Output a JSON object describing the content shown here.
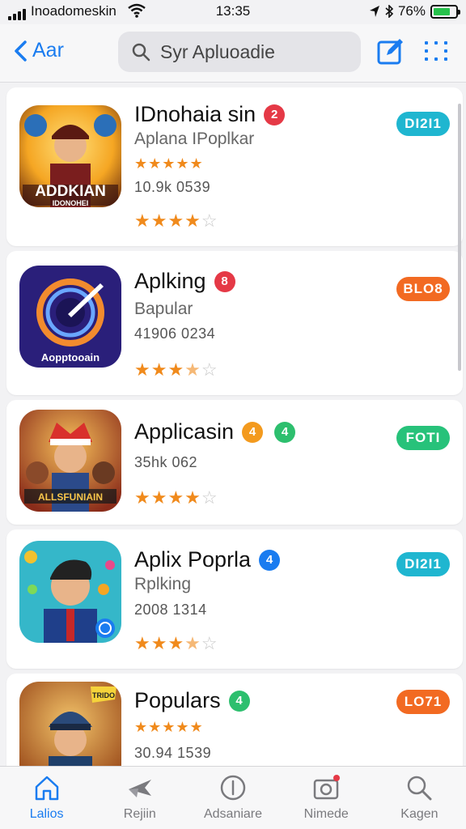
{
  "status_bar": {
    "carrier": "Inoadomeskin",
    "time": "13:35",
    "battery": "76%"
  },
  "nav": {
    "back_label": "Aar",
    "search_placeholder": "Syr Apluoadie"
  },
  "apps": [
    {
      "name": "IDnohaia sin",
      "badge": "2",
      "badge_color": "#e53946",
      "subtitle": "Aplana IPoplkar",
      "meta": "10.9k 0539",
      "top_stars": "★★★★★",
      "rating": 4.5,
      "pill": "DI2I1",
      "pill_color": "#1fb6d0",
      "icon_text_1": "ADDKIAN",
      "icon_text_2": "IDONOHEI"
    },
    {
      "name": "Aplking",
      "badge": "8",
      "badge_color": "#e53946",
      "subtitle": "Bapular",
      "meta": "41906 0234",
      "rating": 3.5,
      "pill": "BLO8",
      "pill_color": "#f26a22",
      "icon_text_1": "Aopptooain"
    },
    {
      "name": "Applicasin",
      "badge": "4",
      "badge_color": "#f39a1e",
      "badge2": "4",
      "badge2_color": "#2dbf6e",
      "meta": "35hk 062",
      "rating": 4.0,
      "pill": "FOTI",
      "pill_color": "#27c27a",
      "icon_text_1": "ALLSFUNIAIN"
    },
    {
      "name": "Aplix Poprla",
      "badge": "4",
      "badge_color": "#1a7cf0",
      "subtitle": "Rplking",
      "meta": "2008 1314",
      "rating": 3.5,
      "pill": "DI2I1",
      "pill_color": "#1fb6d0"
    },
    {
      "name": "Populars",
      "badge": "4",
      "badge_color": "#2dbf6e",
      "top_stars": "★★★★★",
      "meta": "30.94 1539",
      "pill": "LO71",
      "pill_color": "#f26a22",
      "icon_text_1": "TRIDO"
    }
  ],
  "tabs": [
    {
      "label": "Lalios",
      "icon": "home-icon",
      "active": true
    },
    {
      "label": "Rejiin",
      "icon": "plane-icon",
      "active": false
    },
    {
      "label": "Adsaniare",
      "icon": "info-icon",
      "active": false
    },
    {
      "label": "Nimede",
      "icon": "camera-icon",
      "active": false
    },
    {
      "label": "Kagen",
      "icon": "search-icon",
      "active": false
    }
  ]
}
